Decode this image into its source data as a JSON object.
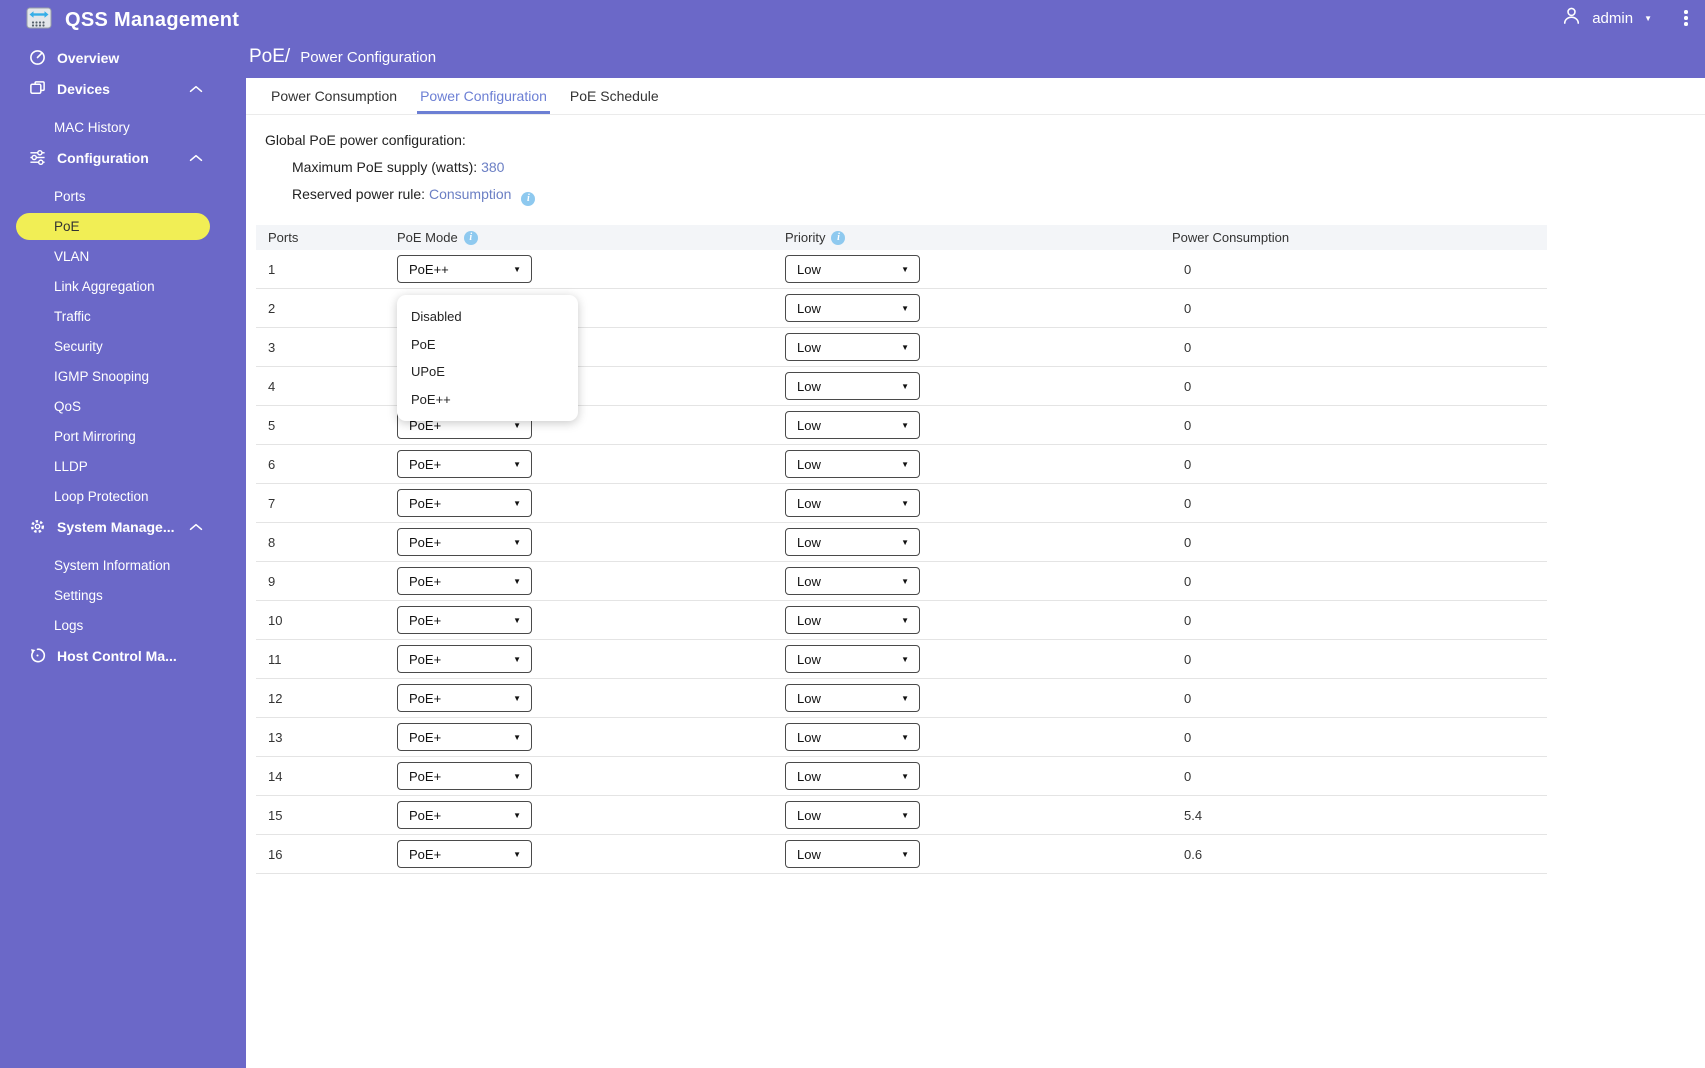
{
  "app": {
    "title": "QSS Management"
  },
  "user": {
    "name": "admin"
  },
  "header": {
    "menu_icon": "kebab-menu-icon",
    "user_icon": "person-icon"
  },
  "sidebar": {
    "items": [
      {
        "label": "Overview",
        "icon": "gauge-icon",
        "children": []
      },
      {
        "label": "Devices",
        "icon": "devices-icon",
        "expanded": true,
        "children": [
          {
            "label": "MAC History"
          }
        ]
      },
      {
        "label": "Configuration",
        "icon": "sliders-icon",
        "expanded": true,
        "children": [
          {
            "label": "Ports"
          },
          {
            "label": "PoE",
            "active": true
          },
          {
            "label": "VLAN"
          },
          {
            "label": "Link Aggregation"
          },
          {
            "label": "Traffic"
          },
          {
            "label": "Security"
          },
          {
            "label": "IGMP Snooping"
          },
          {
            "label": "QoS"
          },
          {
            "label": "Port Mirroring"
          },
          {
            "label": "LLDP"
          },
          {
            "label": "Loop Protection"
          }
        ]
      },
      {
        "label": "System Manage...",
        "icon": "gear-icon",
        "expanded": true,
        "children": [
          {
            "label": "System Information"
          },
          {
            "label": "Settings"
          },
          {
            "label": "Logs"
          }
        ]
      },
      {
        "label": "Host Control Ma...",
        "icon": "history-icon",
        "children": []
      }
    ]
  },
  "breadcrumb": {
    "section": "PoE/",
    "page": "Power Configuration"
  },
  "tabs": [
    {
      "label": "Power Consumption",
      "active": false
    },
    {
      "label": "Power Configuration",
      "active": true
    },
    {
      "label": "PoE Schedule",
      "active": false
    }
  ],
  "global_config": {
    "heading": "Global PoE power configuration:",
    "max_supply_label": "Maximum PoE supply (watts):",
    "max_supply_value": "380",
    "reserved_rule_label": "Reserved power rule:",
    "reserved_rule_value": "Consumption"
  },
  "table": {
    "columns": [
      "Ports",
      "PoE Mode",
      "Priority",
      "Power Consumption"
    ],
    "rows": [
      {
        "port": "1",
        "poe_mode": "PoE++",
        "priority": "Low",
        "power": "0"
      },
      {
        "port": "2",
        "poe_mode": "",
        "priority": "Low",
        "power": "0"
      },
      {
        "port": "3",
        "poe_mode": "",
        "priority": "Low",
        "power": "0"
      },
      {
        "port": "4",
        "poe_mode": "",
        "priority": "Low",
        "power": "0"
      },
      {
        "port": "5",
        "poe_mode": "PoE+",
        "priority": "Low",
        "power": "0"
      },
      {
        "port": "6",
        "poe_mode": "PoE+",
        "priority": "Low",
        "power": "0"
      },
      {
        "port": "7",
        "poe_mode": "PoE+",
        "priority": "Low",
        "power": "0"
      },
      {
        "port": "8",
        "poe_mode": "PoE+",
        "priority": "Low",
        "power": "0"
      },
      {
        "port": "9",
        "poe_mode": "PoE+",
        "priority": "Low",
        "power": "0"
      },
      {
        "port": "10",
        "poe_mode": "PoE+",
        "priority": "Low",
        "power": "0"
      },
      {
        "port": "11",
        "poe_mode": "PoE+",
        "priority": "Low",
        "power": "0"
      },
      {
        "port": "12",
        "poe_mode": "PoE+",
        "priority": "Low",
        "power": "0"
      },
      {
        "port": "13",
        "poe_mode": "PoE+",
        "priority": "Low",
        "power": "0"
      },
      {
        "port": "14",
        "poe_mode": "PoE+",
        "priority": "Low",
        "power": "0"
      },
      {
        "port": "15",
        "poe_mode": "PoE+",
        "priority": "Low",
        "power": "5.4"
      },
      {
        "port": "16",
        "poe_mode": "PoE+",
        "priority": "Low",
        "power": "0.6"
      }
    ]
  },
  "poe_mode_dropdown": {
    "open_for_port": "1",
    "options": [
      "Disabled",
      "PoE",
      "UPoE",
      "PoE++"
    ]
  },
  "colors": {
    "primary_purple": "#6b68c8",
    "active_highlight_yellow": "#f1ee55",
    "tab_accent_blue": "#6c7fd4",
    "link_blue": "#6b7fc4",
    "info_icon_blue": "#8ec9ef",
    "table_header_bg": "#f3f5f8",
    "select_border": "#4a4a4a"
  }
}
